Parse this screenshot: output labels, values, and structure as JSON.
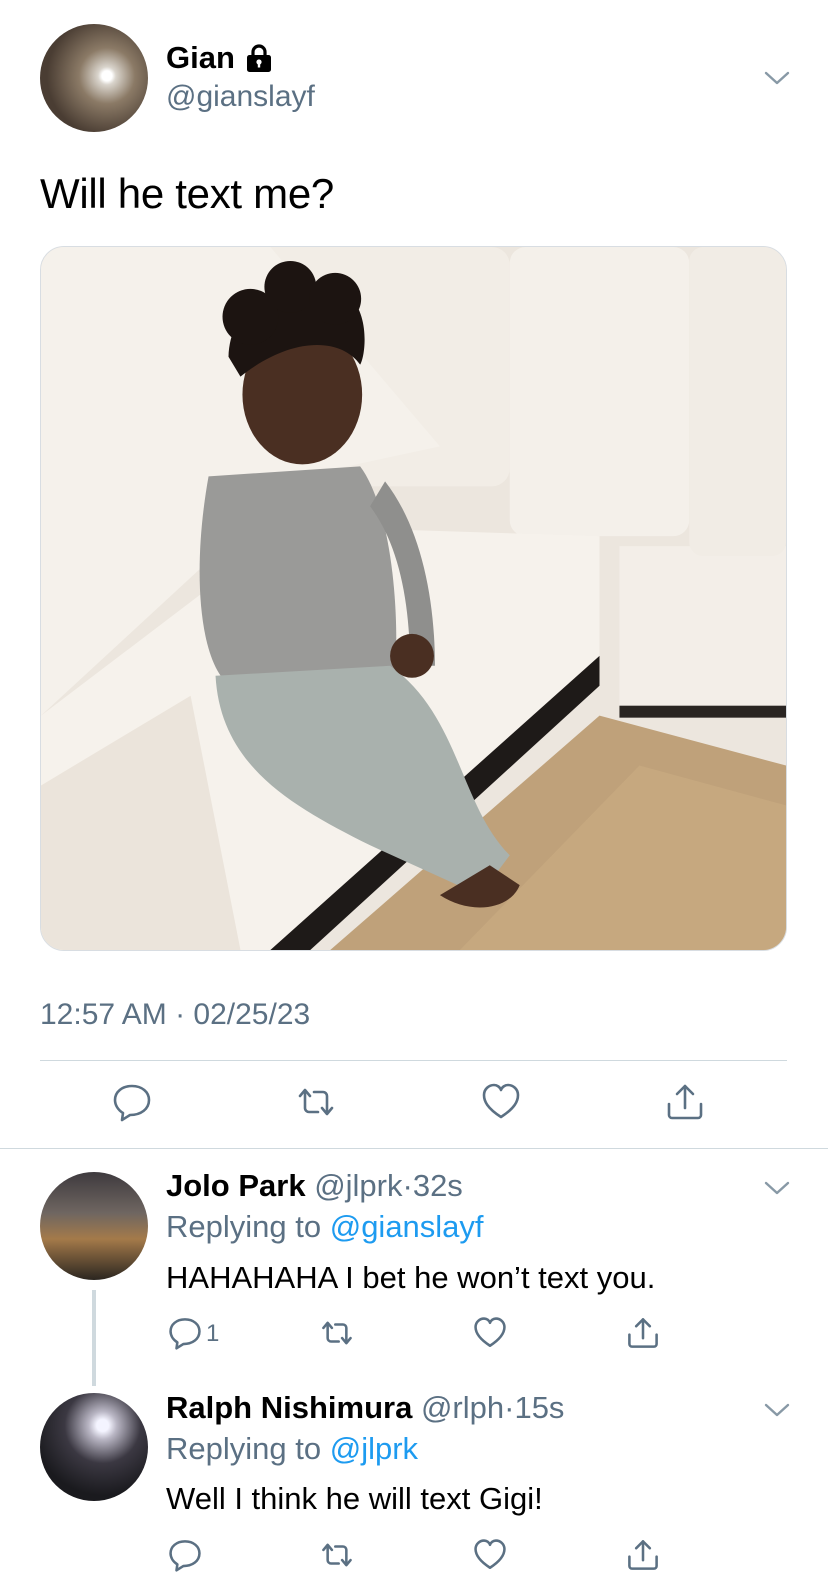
{
  "tweet": {
    "author": {
      "display_name": "Gian",
      "handle": "@gianslayf",
      "protected_icon": "lock-icon"
    },
    "text": "Will he text me?",
    "timestamp": "12:57 AM · 02/25/23",
    "actions": [
      "reply-icon",
      "retweet-icon",
      "like-icon",
      "share-icon"
    ]
  },
  "replies": [
    {
      "display_name": "Jolo Park",
      "handle": "@jlprk",
      "separator": "·",
      "age": "32s",
      "replying_label": "Replying to",
      "replying_to": "@gianslayf",
      "text": "HAHAHAHA I bet he won’t text you.",
      "reply_count": "1"
    },
    {
      "display_name": "Ralph Nishimura",
      "handle": "@rlph",
      "separator": "·",
      "age": "15s",
      "replying_label": "Replying to",
      "replying_to": "@jlprk",
      "text": "Well I think he will text Gigi!"
    }
  ],
  "colors": {
    "accent": "#1d9bf0",
    "muted": "#5b7083",
    "divider": "#cfd9de"
  }
}
